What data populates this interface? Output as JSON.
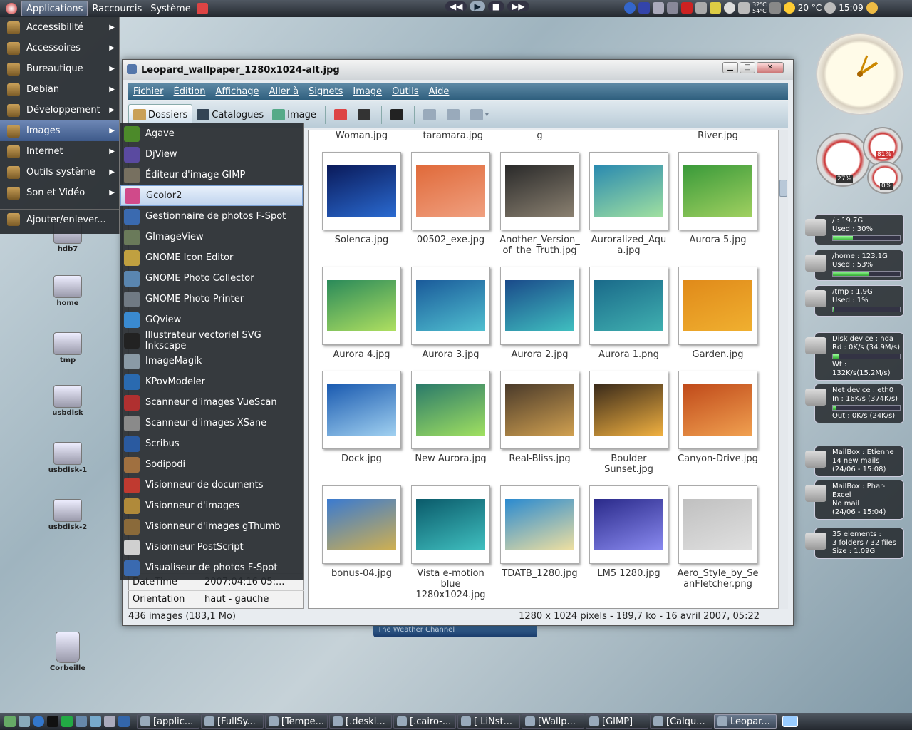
{
  "top_panel": {
    "menus": [
      "Applications",
      "Raccourcis",
      "Système"
    ],
    "temps": [
      "32°C",
      "54°C"
    ],
    "weather": "20 °C",
    "clock": "15:09"
  },
  "app_menu": {
    "items": [
      {
        "label": "Accessibilité",
        "arrow": true,
        "selected": false
      },
      {
        "label": "Accessoires",
        "arrow": true,
        "selected": false
      },
      {
        "label": "Bureautique",
        "arrow": true,
        "selected": false
      },
      {
        "label": "Debian",
        "arrow": true,
        "selected": false
      },
      {
        "label": "Développement",
        "arrow": true,
        "selected": false
      },
      {
        "label": "Images",
        "arrow": true,
        "selected": true
      },
      {
        "label": "Internet",
        "arrow": true,
        "selected": false
      },
      {
        "label": "Outils système",
        "arrow": true,
        "selected": false
      },
      {
        "label": "Son et Vidéo",
        "arrow": true,
        "selected": false
      },
      {
        "label": "Ajouter/enlever...",
        "arrow": false,
        "selected": false
      }
    ]
  },
  "images_submenu": {
    "items": [
      {
        "label": "Agave",
        "color": "#4c8a2a",
        "selected": false
      },
      {
        "label": "DjView",
        "color": "#5a4aa0",
        "selected": false
      },
      {
        "label": "Éditeur d'image GIMP",
        "color": "#777060",
        "selected": false
      },
      {
        "label": "Gcolor2",
        "color": "#d04a8a",
        "selected": true
      },
      {
        "label": "Gestionnaire de photos F-Spot",
        "color": "#3a6ab0",
        "selected": false
      },
      {
        "label": "GImageView",
        "color": "#6a7a5a",
        "selected": false
      },
      {
        "label": "GNOME Icon Editor",
        "color": "#c0a040",
        "selected": false
      },
      {
        "label": "GNOME Photo Collector",
        "color": "#5a86b0",
        "selected": false
      },
      {
        "label": "GNOME Photo Printer",
        "color": "#707a84",
        "selected": false
      },
      {
        "label": "GQview",
        "color": "#3a8ad0",
        "selected": false
      },
      {
        "label": "Illustrateur vectoriel SVG Inkscape",
        "color": "#222222",
        "selected": false
      },
      {
        "label": "ImageMagik",
        "color": "#8a9aa6",
        "selected": false
      },
      {
        "label": "KPovModeler",
        "color": "#2a6ab0",
        "selected": false
      },
      {
        "label": "Scanneur d'images VueScan",
        "color": "#b03030",
        "selected": false
      },
      {
        "label": "Scanneur d'images XSane",
        "color": "#8a8a8a",
        "selected": false
      },
      {
        "label": "Scribus",
        "color": "#2a5aa0",
        "selected": false
      },
      {
        "label": "Sodipodi",
        "color": "#a07040",
        "selected": false
      },
      {
        "label": "Visionneur de documents",
        "color": "#c03a30",
        "selected": false
      },
      {
        "label": "Visionneur d'images",
        "color": "#b08a3a",
        "selected": false
      },
      {
        "label": "Visionneur d'images gThumb",
        "color": "#8a6a3a",
        "selected": false
      },
      {
        "label": "Visionneur PostScript",
        "color": "#d0d0d0",
        "selected": false
      },
      {
        "label": "Visualiseur de photos F-Spot",
        "color": "#3a6ab0",
        "selected": false
      }
    ]
  },
  "window": {
    "title": "Leopard_wallpaper_1280x1024-alt.jpg",
    "menu": [
      "Fichier",
      "Édition",
      "Affichage",
      "Aller à",
      "Signets",
      "Image",
      "Outils",
      "Aide"
    ],
    "toolbar": {
      "folders": "Dossiers",
      "catalogs": "Catalogues",
      "image": "Image"
    },
    "props": [
      {
        "k": "DateTime",
        "v": "2007:04:16 05:..."
      },
      {
        "k": "Orientation",
        "v": "haut - gauche"
      }
    ],
    "status_left": "436 images (183,1 Mo)",
    "status_right": "1280 x 1024 pixels - 189,7 ko - 16 avril 2007, 05:22",
    "top_captions": [
      "Woman.jpg",
      "_taramara.jpg",
      "g",
      "",
      "River.jpg"
    ],
    "thumbs": [
      {
        "name": "Solenca.jpg",
        "c1": "#0a1a5a",
        "c2": "#2a6ad0"
      },
      {
        "name": "00502_exe.jpg",
        "c1": "#e06a3a",
        "c2": "#f0a080"
      },
      {
        "name": "Another_Version_\nof_the_Truth.jpg",
        "c1": "#2a2a2a",
        "c2": "#8a8070"
      },
      {
        "name": "Auroralized_Aqu\na.jpg",
        "c1": "#2a8ab0",
        "c2": "#a0e0a0"
      },
      {
        "name": "Aurora 5.jpg",
        "c1": "#3a9a3a",
        "c2": "#a0d060"
      },
      {
        "name": "Aurora 4.jpg",
        "c1": "#2a8a5a",
        "c2": "#b0e060"
      },
      {
        "name": "Aurora 3.jpg",
        "c1": "#1a5a9a",
        "c2": "#50c0d0"
      },
      {
        "name": "Aurora 2.jpg",
        "c1": "#1a4a8a",
        "c2": "#40c0c0"
      },
      {
        "name": "Aurora 1.png",
        "c1": "#1a6a8a",
        "c2": "#40b0b0"
      },
      {
        "name": "Garden.jpg",
        "c1": "#e08a1a",
        "c2": "#f0b030"
      },
      {
        "name": "Dock.jpg",
        "c1": "#1a5ab0",
        "c2": "#a0d0f0"
      },
      {
        "name": "New Aurora.jpg",
        "c1": "#2a7a6a",
        "c2": "#a0e060"
      },
      {
        "name": "Real-Bliss.jpg",
        "c1": "#4a3a2a",
        "c2": "#d0a050"
      },
      {
        "name": "Boulder\nSunset.jpg",
        "c1": "#3a2a1a",
        "c2": "#f0b040"
      },
      {
        "name": "Canyon-Drive.jpg",
        "c1": "#c04a1a",
        "c2": "#f0a050"
      },
      {
        "name": "bonus-04.jpg",
        "c1": "#3a7ad0",
        "c2": "#d0b050"
      },
      {
        "name": "Vista e-motion\nblue\n1280x1024.jpg",
        "c1": "#0a5a6a",
        "c2": "#40c0c0"
      },
      {
        "name": "TDATB_1280.jpg",
        "c1": "#2a8ad0",
        "c2": "#f0e0a0"
      },
      {
        "name": "LM5 1280.jpg",
        "c1": "#2a2a8a",
        "c2": "#8a8af0"
      },
      {
        "name": "Aero_Style_by_Se\nanFletcher.png",
        "c1": "#c0c0c0",
        "c2": "#e0e0e0"
      }
    ]
  },
  "desktop_icons": [
    "hdb7",
    "home",
    "tmp",
    "usbdisk",
    "usbdisk-1",
    "usbdisk-2",
    "Corbeille"
  ],
  "weather_channel": "The Weather Channel",
  "widgets": [
    {
      "lines": [
        "/ : 19.7G",
        "Used : 30%"
      ],
      "fill": 30
    },
    {
      "lines": [
        "/home : 123.1G",
        "Used : 53%"
      ],
      "fill": 53
    },
    {
      "lines": [
        "/tmp : 1.9G",
        "Used : 1%"
      ],
      "fill": 1
    },
    {
      "lines": [
        "Disk device : hda",
        "Rd : 0K/s   (34.9M/s)",
        "Wt : 132K/s(15.2M/s)"
      ],
      "fill": 10
    },
    {
      "lines": [
        "Net device : eth0",
        "In : 16K/s     (374K/s)",
        "Out : 0K/s      (24K/s)"
      ],
      "fill": 5
    },
    {
      "lines": [
        "MailBox : Etienne",
        "14 new mails",
        "(24/06 - 15:08)"
      ],
      "fill": null
    },
    {
      "lines": [
        "MailBox : Phar-Excel",
        "No mail",
        "(24/06 - 15:04)"
      ],
      "fill": null
    },
    {
      "lines": [
        "35 elements :",
        "3 folders / 32 files",
        "Size : 1.09G"
      ],
      "fill": null
    }
  ],
  "gauges": {
    "cpu": "27%",
    "mem": "81%",
    "swap": "0%"
  },
  "taskbar": [
    "[applic...",
    "[FullSy...",
    "[Tempe...",
    "[.deskl...",
    "[.cairo-...",
    "[ LiNst...",
    "[Wallp...",
    "[GIMP]",
    "[Calqu...",
    "Leopar..."
  ]
}
